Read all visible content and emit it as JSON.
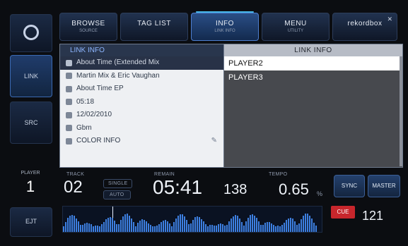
{
  "rail": {
    "items": [
      {
        "label": "",
        "sub": ""
      },
      {
        "label": "LINK",
        "sub": ""
      },
      {
        "label": "SRC",
        "sub": ""
      }
    ],
    "player_label": "PLAYER",
    "player_number": "1",
    "bottom_label": "EJT"
  },
  "tabs": [
    {
      "title": "BROWSE",
      "sub": "SOURCE"
    },
    {
      "title": "TAG LIST",
      "sub": ""
    },
    {
      "title": "INFO",
      "sub": "LINK INFO"
    },
    {
      "title": "MENU",
      "sub": "UTILITY"
    },
    {
      "title": "rekordbox",
      "sub": ""
    }
  ],
  "left_pane": {
    "header": "LINK INFO",
    "rows": [
      {
        "icon": "music-icon",
        "text": "About Time (Extended Mix"
      },
      {
        "icon": "artist-icon",
        "text": "Martin Mix & Eric Vaughan"
      },
      {
        "icon": "album-icon",
        "text": "About Time EP"
      },
      {
        "icon": "time-icon",
        "text": "05:18"
      },
      {
        "icon": "date-icon",
        "text": "12/02/2010"
      },
      {
        "icon": "key-icon",
        "text": "Gbm"
      },
      {
        "icon": "comment-icon",
        "text": "COLOR INFO"
      }
    ]
  },
  "right_pane": {
    "header": "LINK INFO",
    "rows": [
      {
        "text": "PLAYER2"
      },
      {
        "text": "PLAYER3"
      }
    ]
  },
  "deck": {
    "track_label": "TRACK",
    "track_number": "02",
    "mode_label": "SINGLE",
    "auto_label": "AUTO",
    "time_label": "REMAIN",
    "time_value": "05:41",
    "bpm_value": "138",
    "tempo_label": "TEMPO",
    "tempo_value": "0.65",
    "tempo_unit": "%",
    "sync_label": "SYNC",
    "master_label": "MASTER",
    "cue_label": "CUE",
    "bpm_right": "121"
  }
}
